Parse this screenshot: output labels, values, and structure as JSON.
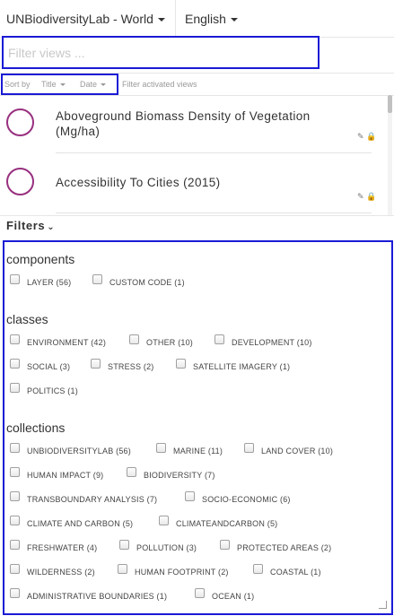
{
  "header": {
    "workspace_label": "UNBiodiversityLab - World",
    "language_label": "English"
  },
  "search": {
    "placeholder": "Filter views ...",
    "value": ""
  },
  "sort": {
    "sort_by_label": "Sort by",
    "title_option": "Title",
    "date_option": "Date",
    "filter_activated": "Filter activated views"
  },
  "views": [
    {
      "title": "Aboveground Biomass Density of Vegetation (Mg/ha)"
    },
    {
      "title": "Accessibility To Cities (2015)"
    }
  ],
  "filters": {
    "heading": "Filters",
    "sections": [
      {
        "label": "components",
        "items": [
          "LAYER (56)",
          "CUSTOM CODE (1)"
        ]
      },
      {
        "label": "classes",
        "items": [
          "ENVIRONMENT (42)",
          "OTHER (10)",
          "DEVELOPMENT (10)",
          "SOCIAL (3)",
          "STRESS (2)",
          "SATELLITE IMAGERY (1)",
          "POLITICS (1)"
        ]
      },
      {
        "label": "collections",
        "items": [
          "UNBIODIVERSITYLAB (56)",
          "MARINE (11)",
          "LAND COVER (10)",
          "HUMAN IMPACT (9)",
          "BIODIVERSITY (7)",
          "TRANSBOUNDARY ANALYSIS (7)",
          "SOCIO-ECONOMIC (6)",
          "CLIMATE AND CARBON (5)",
          "CLIMATEANDCARBON (5)",
          "FRESHWATER (4)",
          "POLLUTION (3)",
          "PROTECTED AREAS (2)",
          "WILDERNESS (2)",
          "HUMAN FOOTPRINT (2)",
          "COASTAL (1)",
          "ADMINISTRATIVE BOUNDARIES (1)",
          "OCEAN (1)"
        ]
      }
    ]
  },
  "colors": {
    "highlight_border": "#1a1ad6",
    "circle": "#98307f"
  },
  "icons": {
    "tool_icons": [
      "pin-icon",
      "lock-icon"
    ]
  }
}
